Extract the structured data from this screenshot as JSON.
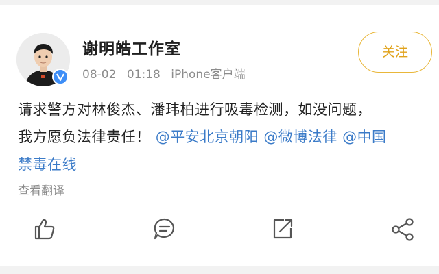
{
  "post": {
    "author": "谢明皓工作室",
    "date": "08-02",
    "time": "01:18",
    "source": "iPhone客户端",
    "follow_label": "关注",
    "text_lines": [
      "请求警方对林俊杰、潘玮柏进行吸毒检测，如没问题，",
      "我方愿负法律责任！"
    ],
    "mentions": [
      "@平安北京朝阳",
      "@微博法律",
      "@中国",
      "禁毒在线"
    ],
    "translate_label": "查看翻译"
  },
  "colors": {
    "mention": "#3b7bc8",
    "follow": "#e0a21a",
    "verified": "#3e8ef7"
  },
  "icons": [
    "like-icon",
    "comment-icon",
    "share-icon",
    "repost-icon",
    "verified-icon"
  ]
}
